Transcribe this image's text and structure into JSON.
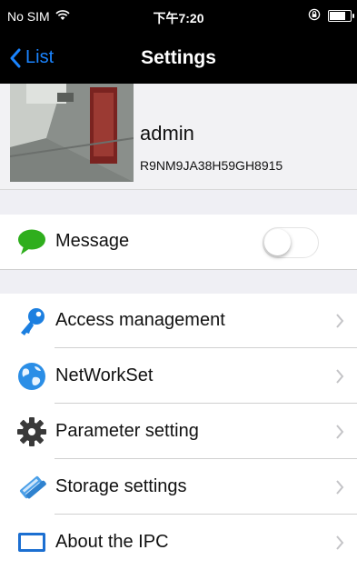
{
  "status_bar": {
    "carrier": "No SIM",
    "time": "下午7:20",
    "battery_level": 0.85
  },
  "nav": {
    "back_label": "List",
    "title": "Settings"
  },
  "profile": {
    "name": "admin",
    "device_id": "R9NM9JA38H59GH8915"
  },
  "message": {
    "label": "Message",
    "enabled": false,
    "icon": "speech-bubble-icon",
    "icon_color": "#2fae1d"
  },
  "menu": [
    {
      "label": "Access management",
      "icon": "key-icon"
    },
    {
      "label": "NetWorkSet",
      "icon": "globe-icon"
    },
    {
      "label": "Parameter setting",
      "icon": "gear-icon"
    },
    {
      "label": "Storage settings",
      "icon": "storage-icon"
    },
    {
      "label": "About the IPC",
      "icon": "monitor-icon"
    }
  ],
  "colors": {
    "accent": "#1a84ff",
    "bar_background": "#000000",
    "group_background": "#efeff4"
  }
}
